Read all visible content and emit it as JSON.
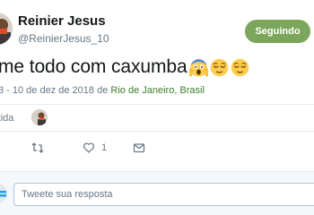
{
  "author": {
    "display_name": "Reinier Jesus",
    "username": "@ReinierJesus_10"
  },
  "follow_button": {
    "label": "Seguindo"
  },
  "tweet": {
    "text": "me todo com caxumba",
    "emojis": [
      "face-screaming-in-fear-icon",
      "relieved-face-icon",
      "relieved-face-icon"
    ],
    "time_date": "3 - 10 de dez de 2018 de ",
    "location": "Rio de Janeiro, Brasil"
  },
  "retweet_row": {
    "label": "rtida"
  },
  "actions": {
    "like_count": "1"
  },
  "reply": {
    "placeholder": "Tweete sua resposta",
    "value": ""
  },
  "colors": {
    "follow_button_bg": "#7ba65c",
    "location_link": "#3d7e2a",
    "secondary_text": "#657786",
    "reply_bar_bg": "#f5f8fa"
  }
}
